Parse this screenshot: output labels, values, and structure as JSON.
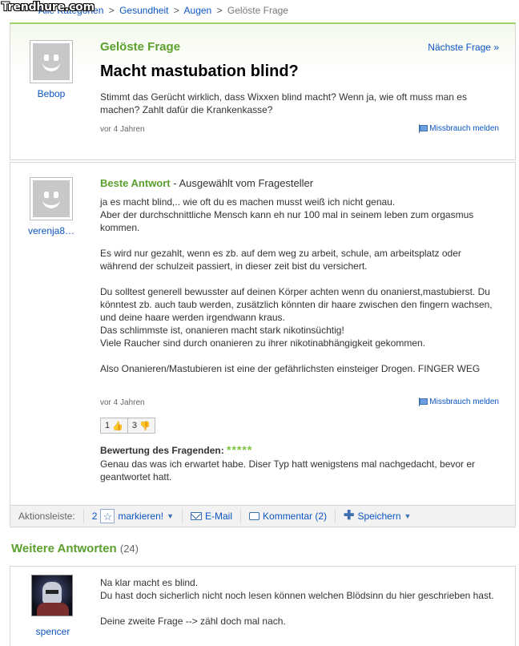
{
  "watermark": "Trendhure.com",
  "breadcrumb": {
    "home": "Startseite",
    "all_categories": "Alle Kategorien",
    "health": "Gesundheit",
    "eyes": "Augen",
    "current": "Gelöste Frage",
    "sep": ">"
  },
  "question": {
    "label": "Gelöste Frage",
    "next_link": "Nächste Frage »",
    "title": "Macht mastubation blind?",
    "body": "Stimmt das Gerücht wirklich, dass Wixxen blind macht? Wenn ja, wie oft muss man es machen? Zahlt dafür die Krankenkasse?",
    "user": "Bebop",
    "time": "vor 4 Jahren",
    "report": "Missbrauch melden"
  },
  "best_answer": {
    "label": "Beste Antwort",
    "selected_by": " - Ausgewählt vom Fragesteller",
    "user": "verenja8…",
    "paragraphs": [
      "ja es macht blind,.. wie oft du es machen musst weiß ich nicht genau.\nAber der durchschnittliche Mensch kann eh nur 100 mal in seinem leben zum orgasmus kommen.",
      "Es wird nur gezahlt, wenn es zb. auf dem weg zu arbeit, schule, am arbeitsplatz oder während der schulzeit passiert, in dieser zeit bist du versichert.",
      "Du solltest generell bewusster auf deinen Körper achten wenn du onanierst,mastubierst. Du könntest zb. auch taub werden, zusätzlich könnten dir haare zwischen den fingern wachsen, und deine haare werden irgendwann kraus.\nDas schlimmste ist, onanieren macht stark nikotinsüchtig!\nViele Raucher sind durch onanieren zu ihrer nikotinabhängigkeit gekommen.",
      "Also Onanieren/Mastubieren ist eine der gefährlichsten einsteiger Drogen. FINGER WEG"
    ],
    "time": "vor 4 Jahren",
    "report": "Missbrauch melden",
    "votes_up": "1",
    "votes_down": "3",
    "rating_label": "Bewertung des Fragenden:",
    "rating_stars": "*****",
    "rating_text": "Genau das was ich erwartet habe. Diser Typ hatt wenigstens mal nachgedacht, bevor er geantwortet hatt."
  },
  "actionbar": {
    "label": "Aktionsleiste:",
    "star_count": "2",
    "mark": "markieren!",
    "email": "E-Mail",
    "comment": "Kommentar (2)",
    "save": "Speichern"
  },
  "more_answers": {
    "heading": "Weitere Antworten",
    "count": "(24)",
    "items": [
      {
        "user": "spencer",
        "text": "Na klar macht es blind.\nDu hast doch sicherlich nicht noch lesen können welchen Blödsinn du hier geschrieben hast.\n\nDeine zweite Frage --> zähl doch mal nach."
      }
    ]
  },
  "colors": {
    "accent_green": "#5aa02c",
    "link_blue": "#0b55c4",
    "star_green": "#7cc43a"
  }
}
